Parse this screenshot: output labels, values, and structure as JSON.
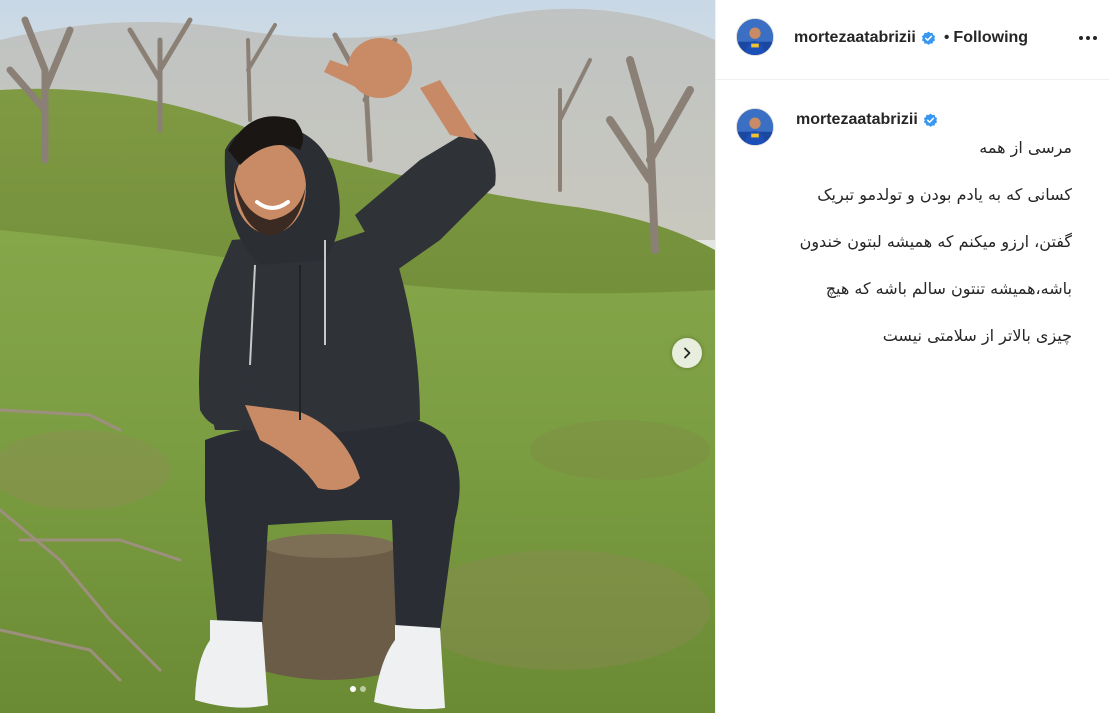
{
  "post": {
    "username": "mortezaatabrizii",
    "verified": true,
    "separator": "•",
    "follow_state": "Following",
    "caption_lines": [
      "مرسی از همه",
      "کسانی که به یادم بودن و تولدمو تبریک",
      "گفتن، ارزو میکنم که همیشه لبتون خندون",
      "باشه،همیشه تنتون سالم باشه که هیچ",
      "چیزی بالاتر از سلامتی نیست"
    ],
    "carousel": {
      "slide_count": 2,
      "active_index": 0
    }
  },
  "icons": {
    "verified": "verified-badge-icon",
    "more": "more-options-icon",
    "next": "chevron-right-icon"
  },
  "colors": {
    "verified_blue": "#3897f0",
    "text": "#262626",
    "divider": "#efefef"
  }
}
